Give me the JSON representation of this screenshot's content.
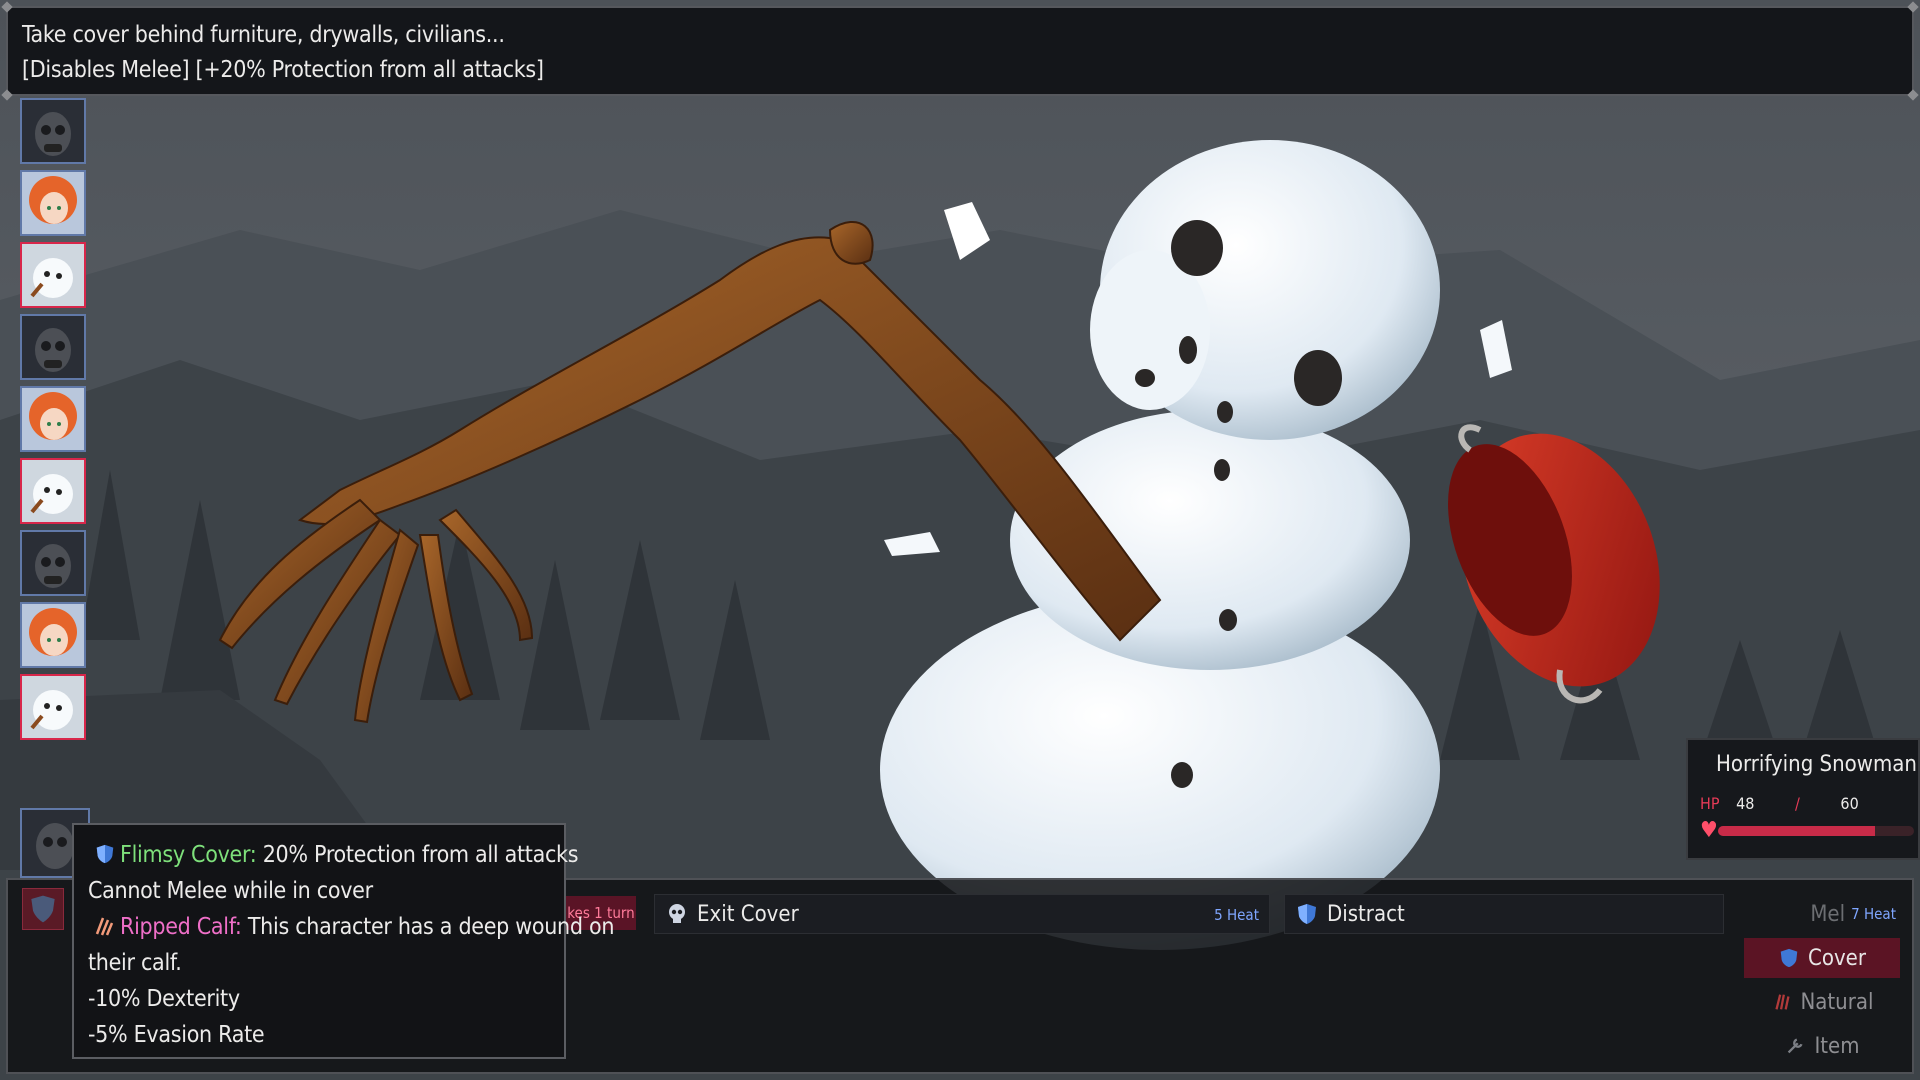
{
  "top_tooltip": {
    "line1": "Take cover behind furniture, drywalls, civilians...",
    "line2": "[Disables Melee] [+20% Protection from all attacks]"
  },
  "turn_order": [
    {
      "name": "masked-soldier",
      "team": "ally"
    },
    {
      "name": "red-haired-girl",
      "team": "ally"
    },
    {
      "name": "horrifying-snowman",
      "team": "enemy"
    },
    {
      "name": "masked-soldier",
      "team": "ally"
    },
    {
      "name": "red-haired-girl",
      "team": "ally"
    },
    {
      "name": "horrifying-snowman",
      "team": "enemy"
    },
    {
      "name": "masked-soldier",
      "team": "ally"
    },
    {
      "name": "red-haired-girl",
      "team": "ally"
    },
    {
      "name": "horrifying-snowman",
      "team": "enemy"
    }
  ],
  "status_tooltip": {
    "flimsy_title": "Flimsy Cover:",
    "flimsy_desc": " 20% Protection from all attacks",
    "cover_note": "Cannot Melee while in cover",
    "calf_title": "Ripped Calf:",
    "calf_desc": " This character has a deep wound on",
    "calf_desc2": "their calf.",
    "stat1": "-10% Dexterity",
    "stat2": "-5% Evasion Rate"
  },
  "enemy": {
    "name": "Horrifying Snowman",
    "hp_label": "HP",
    "hp_current": "48",
    "hp_separator": "/",
    "hp_max": "60",
    "hp_fraction": 0.8
  },
  "actions": {
    "turn_chip": "kes 1 turn",
    "exit_cover": "Exit Cover",
    "exit_cover_cost": "5 Heat",
    "distract": "Distract",
    "melee_partial": "Mel",
    "melee_cost": "7 Heat"
  },
  "tabs": {
    "cover": "Cover",
    "natural": "Natural",
    "item": "Item"
  },
  "colors": {
    "accent_red": "#d8264a",
    "heat_blue": "#7fa6ff",
    "buff_green": "#7ee07b",
    "debuff_pink": "#ef6fc8"
  }
}
